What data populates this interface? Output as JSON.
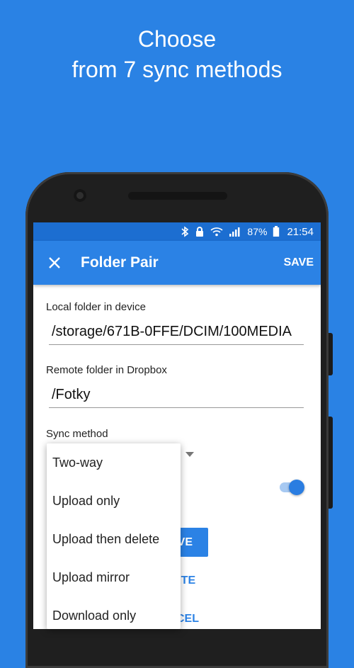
{
  "promo": {
    "line1": "Choose",
    "line2": "from 7 sync methods"
  },
  "status_bar": {
    "battery": "87%",
    "time": "21:54"
  },
  "app_bar": {
    "title": "Folder Pair",
    "save_label": "SAVE"
  },
  "form": {
    "local_label": "Local folder in device",
    "local_value": "/storage/671B-0FFE/DCIM/100MEDIA",
    "remote_label": "Remote folder in Dropbox",
    "remote_value": "/Fotky",
    "sync_label": "Sync method"
  },
  "sync_menu": {
    "options": [
      "Two-way",
      "Upload only",
      "Upload then delete",
      "Upload mirror",
      "Download only"
    ]
  },
  "toggle": {
    "enabled": true
  },
  "partial_buttons": {
    "save_tail": "VE",
    "delete_tail": "ETE",
    "cancel_tail": "CEL"
  },
  "colors": {
    "accent": "#2b82e5",
    "status_bar": "#1c6ed1",
    "background": "#2a82e4"
  }
}
